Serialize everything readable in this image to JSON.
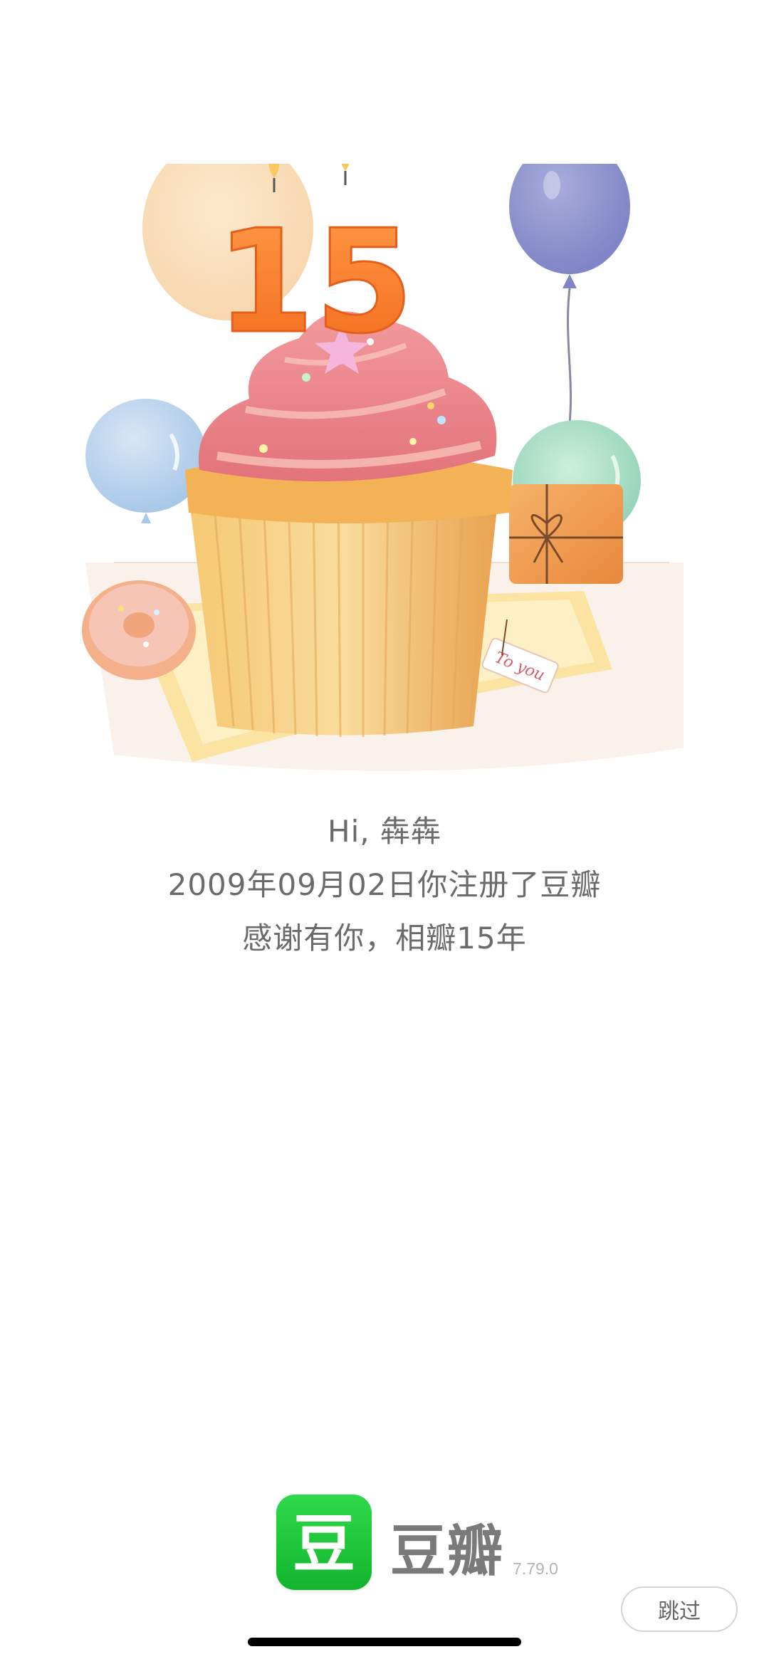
{
  "illustration": {
    "candle_number": "15",
    "gift_tag_text": "To you"
  },
  "greeting": {
    "line1": "Hi, 犇犇",
    "line2": "2009年09月02日你注册了豆瓣",
    "line3": "感谢有你，相瓣15年"
  },
  "brand": {
    "logo_glyph": "豆",
    "name": "豆瓣",
    "version": "7.79.0",
    "logo_color": "#1dc13a"
  },
  "skip": {
    "label": "跳过"
  }
}
